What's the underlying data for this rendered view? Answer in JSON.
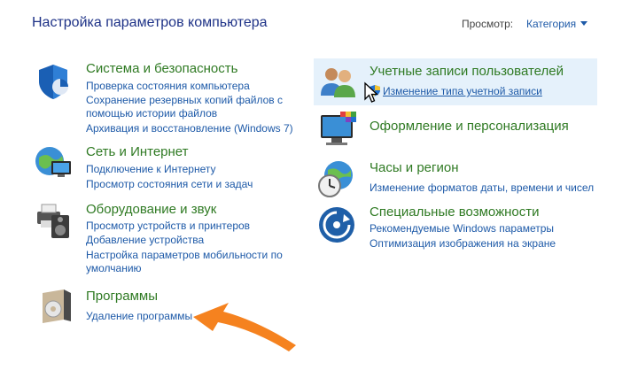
{
  "header": {
    "title": "Настройка параметров компьютера",
    "view_label": "Просмотр:",
    "view_value": "Категория"
  },
  "categories": {
    "security": {
      "title": "Система и безопасность",
      "links": [
        "Проверка состояния компьютера",
        "Сохранение резервных копий файлов с",
        "помощью истории файлов",
        "Архивация и восстановление (Windows 7)"
      ]
    },
    "network": {
      "title": "Сеть и Интернет",
      "links": [
        "Подключение к Интернету",
        "Просмотр состояния сети и задач"
      ]
    },
    "hardware": {
      "title": "Оборудование и звук",
      "links": [
        "Просмотр устройств и принтеров",
        "Добавление устройства",
        "Настройка параметров мобильности по",
        "умолчанию"
      ]
    },
    "programs": {
      "title": "Программы",
      "links": [
        "Удаление программы"
      ]
    },
    "accounts": {
      "title": "Учетные записи пользователей",
      "links": [
        "Изменение типа учетной записи"
      ]
    },
    "appearance": {
      "title": "Оформление и персонализация",
      "links": []
    },
    "clock": {
      "title": "Часы и регион",
      "links": [
        "Изменение форматов даты, времени и чисел"
      ]
    },
    "ease": {
      "title": "Специальные возможности",
      "links": [
        "Рекомендуемые Windows параметры",
        "Оптимизация изображения на экране"
      ]
    }
  },
  "colors": {
    "category_title": "#2f7a23",
    "link": "#1e5aa8",
    "page_title": "#1e3287",
    "highlight": "#e5f1fb",
    "annotation_arrow": "#f5821f"
  }
}
